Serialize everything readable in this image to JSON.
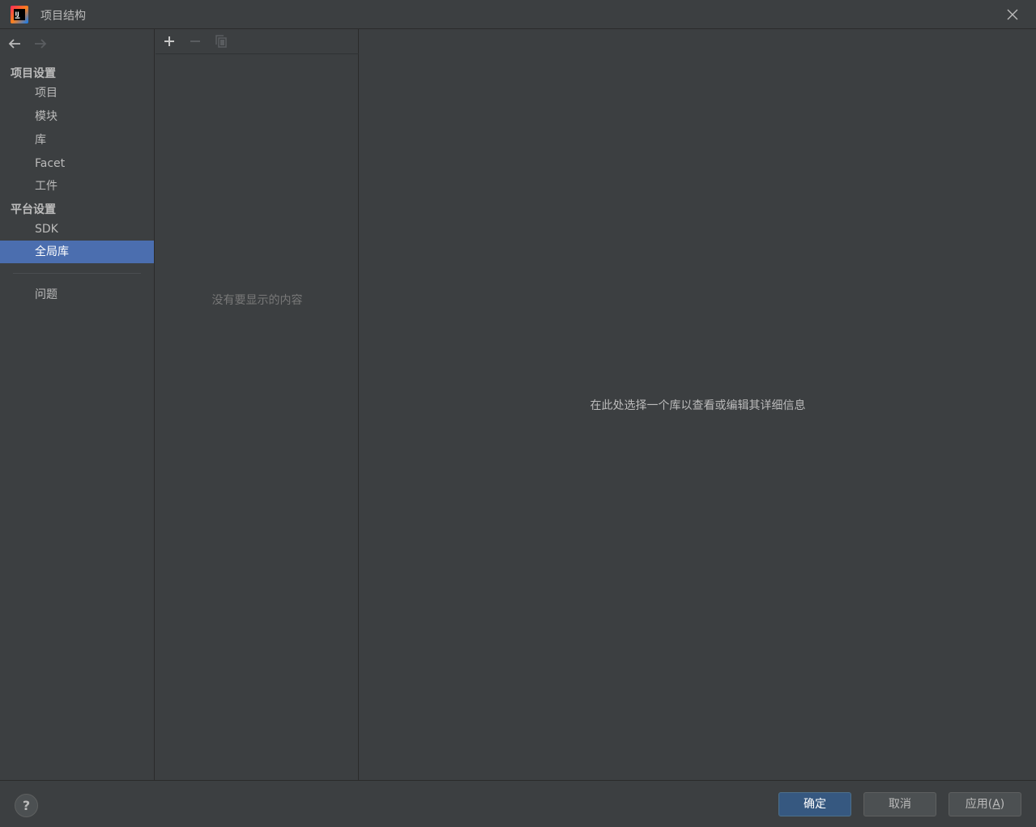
{
  "window": {
    "title": "项目结构"
  },
  "sidebar": {
    "sections": [
      {
        "header": "项目设置",
        "items": [
          "项目",
          "模块",
          "库",
          "Facet",
          "工件"
        ]
      },
      {
        "header": "平台设置",
        "items": [
          "SDK",
          "全局库"
        ]
      }
    ],
    "selected_item": "全局库",
    "extra_items": [
      "问题"
    ]
  },
  "list_pane": {
    "empty_text": "没有要显示的内容"
  },
  "detail_pane": {
    "hint_text": "在此处选择一个库以查看或编辑其详细信息"
  },
  "footer": {
    "help_label": "?",
    "ok_label": "确定",
    "cancel_label": "取消",
    "apply_label_prefix": "应用(",
    "apply_mnemonic": "A",
    "apply_label_suffix": ")"
  },
  "colors": {
    "background": "#3c3f41",
    "selection": "#4b6eaf",
    "primary_button": "#365880"
  }
}
